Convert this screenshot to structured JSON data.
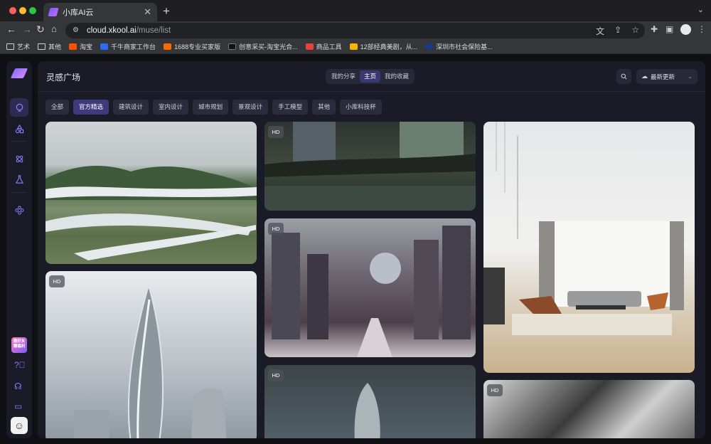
{
  "browser": {
    "tab_title": "小库AI云",
    "url_host": "cloud.xkool.ai",
    "url_path": "/muse/list",
    "bookmarks": [
      {
        "label": "艺术",
        "icon": "folder-icon",
        "color": ""
      },
      {
        "label": "其他",
        "icon": "folder-icon",
        "color": ""
      },
      {
        "label": "淘宝",
        "icon": "taobao-icon",
        "color": "#ff5000"
      },
      {
        "label": "千牛商家工作台",
        "icon": "qianniu-icon",
        "color": "#2a6df5"
      },
      {
        "label": "1688专业买家版",
        "icon": "1688-icon",
        "color": "#ff6a00"
      },
      {
        "label": "创意采买-淘宝光合...",
        "icon": "creative-icon",
        "color": "#111111"
      },
      {
        "label": "商品工具",
        "icon": "tool-icon",
        "color": "#e8403a"
      },
      {
        "label": "12部经典美剧，从...",
        "icon": "s-icon",
        "color": "#f5b400"
      },
      {
        "label": "深圳市社会保险基...",
        "icon": "gov-icon",
        "color": "#1b3a8c"
      }
    ]
  },
  "app": {
    "page_title": "灵感广场",
    "view_tabs": [
      {
        "label": "我的分享",
        "active": false
      },
      {
        "label": "主页",
        "active": true
      },
      {
        "label": "我的收藏",
        "active": false
      }
    ],
    "sort_label": "最新更新",
    "promo_text": "邀好友 赚福利",
    "filters": [
      {
        "label": "全部",
        "active": false
      },
      {
        "label": "官方精选",
        "active": true
      },
      {
        "label": "建筑设计",
        "active": false
      },
      {
        "label": "室内设计",
        "active": false
      },
      {
        "label": "城市规划",
        "active": false
      },
      {
        "label": "景观设计",
        "active": false
      },
      {
        "label": "手工模型",
        "active": false
      },
      {
        "label": "其他",
        "active": false
      },
      {
        "label": "小库科技杯",
        "active": false
      }
    ],
    "hd_label": "HD",
    "accent": "#8f7bff"
  }
}
